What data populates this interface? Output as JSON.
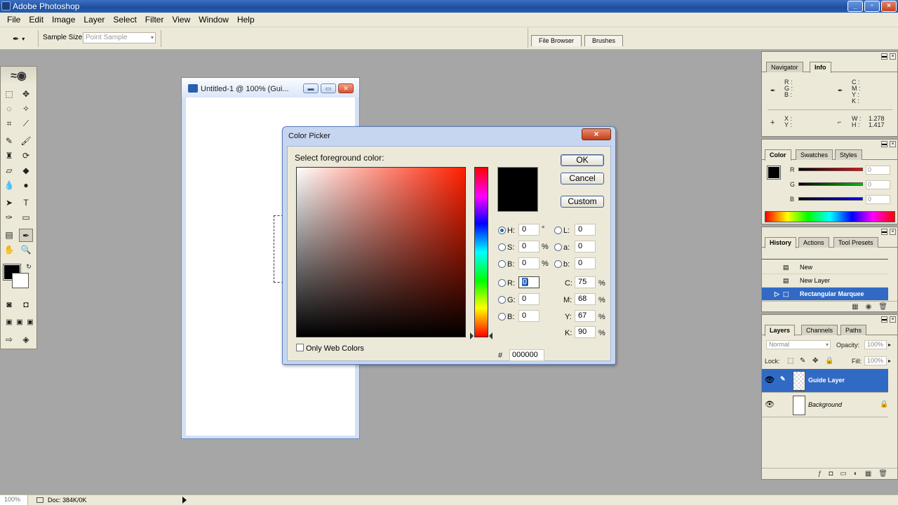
{
  "app": {
    "title": "Adobe Photoshop"
  },
  "menu": [
    "File",
    "Edit",
    "Image",
    "Layer",
    "Select",
    "Filter",
    "View",
    "Window",
    "Help"
  ],
  "options": {
    "sample_size_label": "Sample Size:",
    "sample_size_value": "Point Sample"
  },
  "well_tabs": [
    "File Browser",
    "Brushes"
  ],
  "document": {
    "title": "Untitled-1 @ 100% (Gui..."
  },
  "color_picker": {
    "title": "Color Picker",
    "prompt": "Select foreground color:",
    "buttons": {
      "ok": "OK",
      "cancel": "Cancel",
      "custom": "Custom"
    },
    "hsb": [
      {
        "label": "H:",
        "value": "0",
        "unit": "°"
      },
      {
        "label": "S:",
        "value": "0",
        "unit": "%"
      },
      {
        "label": "B:",
        "value": "0",
        "unit": "%"
      }
    ],
    "rgb": [
      {
        "label": "R:",
        "value": "0"
      },
      {
        "label": "G:",
        "value": "0"
      },
      {
        "label": "B:",
        "value": "0"
      }
    ],
    "lab": [
      {
        "label": "L:",
        "value": "0"
      },
      {
        "label": "a:",
        "value": "0"
      },
      {
        "label": "b:",
        "value": "0"
      }
    ],
    "cmyk": [
      {
        "label": "C:",
        "value": "75",
        "unit": "%"
      },
      {
        "label": "M:",
        "value": "68",
        "unit": "%"
      },
      {
        "label": "Y:",
        "value": "67",
        "unit": "%"
      },
      {
        "label": "K:",
        "value": "90",
        "unit": "%"
      }
    ],
    "hex_label": "#",
    "hex": "000000",
    "web_only_label": "Only Web Colors",
    "current_color": "#000000"
  },
  "navigator_palette": {
    "tabs": [
      "Navigator",
      "Info"
    ],
    "rgb_labels": [
      "R :",
      "G :",
      "B :"
    ],
    "cmyk_labels": [
      "C :",
      "M :",
      "Y :",
      "K :"
    ],
    "xy_labels": [
      "X :",
      "Y :"
    ],
    "wh_labels": [
      "W :",
      "H :"
    ],
    "wh_values": [
      "1.278",
      "1.417"
    ]
  },
  "color_palette": {
    "tabs": [
      "Color",
      "Swatches",
      "Styles"
    ],
    "sliders": [
      {
        "label": "R",
        "value": "0",
        "color": "#ff0000"
      },
      {
        "label": "G",
        "value": "0",
        "color": "#00c000"
      },
      {
        "label": "B",
        "value": "0",
        "color": "#0000ff"
      }
    ]
  },
  "history_palette": {
    "tabs": [
      "History",
      "Actions",
      "Tool Presets"
    ],
    "items": [
      "New",
      "New Layer",
      "Rectangular Marquee"
    ]
  },
  "layers_palette": {
    "tabs": [
      "Layers",
      "Channels",
      "Paths"
    ],
    "blend_mode": "Normal",
    "opacity_label": "Opacity:",
    "opacity_value": "100%",
    "lock_label": "Lock:",
    "fill_label": "Fill:",
    "fill_value": "100%",
    "layers": [
      "Guide Layer",
      "Background"
    ]
  },
  "status": {
    "zoom": "100%",
    "doc": "Doc: 384K/0K"
  }
}
